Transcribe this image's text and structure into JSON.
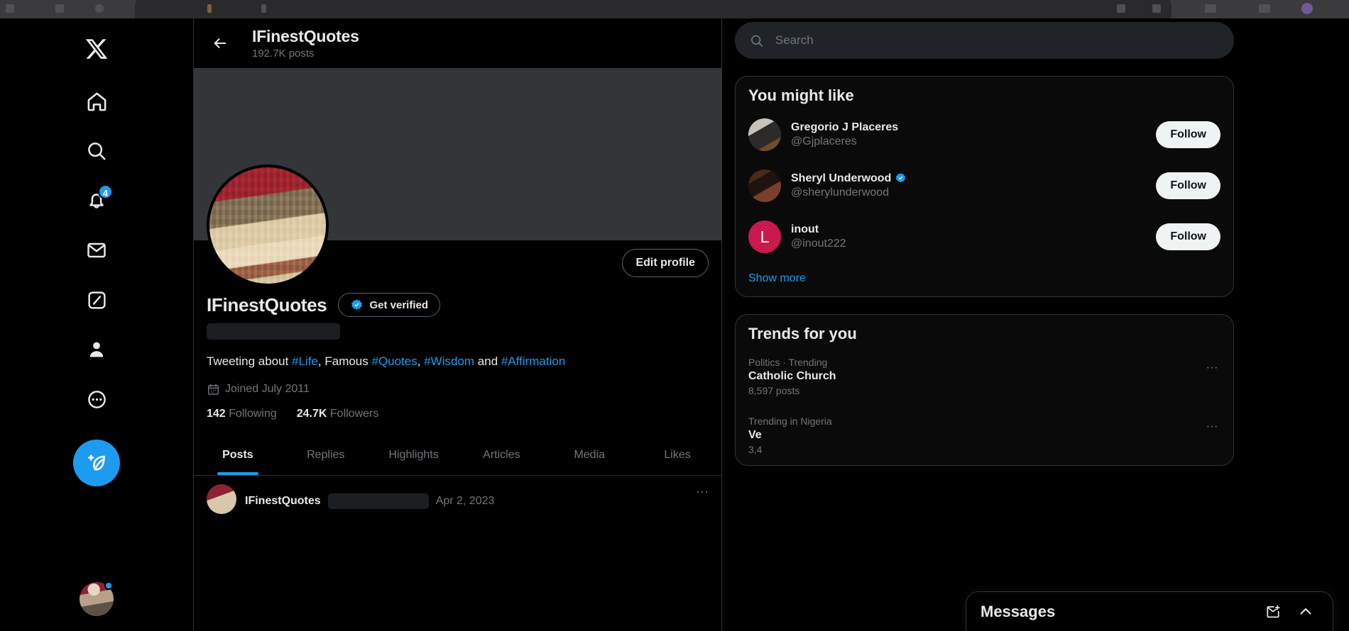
{
  "nav": {
    "items": [
      {
        "name": "x-logo",
        "label": "X"
      },
      {
        "name": "home",
        "label": "Home"
      },
      {
        "name": "explore",
        "label": "Search"
      },
      {
        "name": "notifications",
        "label": "Notifications",
        "badge": "4"
      },
      {
        "name": "messages",
        "label": "Messages"
      },
      {
        "name": "grok",
        "label": "Grok"
      },
      {
        "name": "profile",
        "label": "Profile"
      },
      {
        "name": "more",
        "label": "More"
      }
    ],
    "compose_label": "Post"
  },
  "header": {
    "title": "IFinestQuotes",
    "posts_count": "192.7K posts",
    "back_label": "Back"
  },
  "profile": {
    "display_name": "IFinestQuotes",
    "get_verified_label": "Get verified",
    "edit_profile_label": "Edit profile",
    "bio_prefix": "Tweeting about ",
    "bio_tag_1": "#Life",
    "bio_mid_1": ", Famous ",
    "bio_tag_2": "#Quotes",
    "bio_mid_2": ", ",
    "bio_tag_3": "#Wisdom",
    "bio_mid_3": " and ",
    "bio_tag_4": "#Affirmation",
    "joined": "Joined July 2011",
    "following_count": "142",
    "following_label": "Following",
    "followers_count": "24.7K",
    "followers_label": "Followers"
  },
  "tabs": [
    {
      "label": "Posts",
      "active": true
    },
    {
      "label": "Replies",
      "active": false
    },
    {
      "label": "Highlights",
      "active": false
    },
    {
      "label": "Articles",
      "active": false
    },
    {
      "label": "Media",
      "active": false
    },
    {
      "label": "Likes",
      "active": false
    }
  ],
  "feed_peek": {
    "author": "IFinestQuotes",
    "date": "Apr 2, 2023",
    "more": "···"
  },
  "search": {
    "placeholder": "Search",
    "value": ""
  },
  "you_might_like": {
    "title": "You might like",
    "show_more": "Show more",
    "follow_label": "Follow",
    "items": [
      {
        "name": "Gregorio J Placeres",
        "handle": "@Gjplaceres",
        "verified": false,
        "avatar_kind": "photo-1",
        "initial": ""
      },
      {
        "name": "Sheryl Underwood",
        "handle": "@sherylunderwood",
        "verified": true,
        "avatar_kind": "photo-2",
        "initial": ""
      },
      {
        "name": "inout",
        "handle": "@inout222",
        "verified": false,
        "avatar_kind": "letter",
        "initial": "L",
        "avatar_color": "#c9194e"
      }
    ]
  },
  "trends": {
    "title": "Trends for you",
    "items": [
      {
        "category": "Politics · Trending",
        "name": "Catholic Church",
        "count": "8,597 posts",
        "more": "···"
      },
      {
        "category": "Trending in Nigeria",
        "name": "Ve",
        "count": "3,4",
        "more": "···"
      }
    ]
  },
  "messages_dock": {
    "title": "Messages",
    "new_message_label": "New message",
    "expand_label": "Expand"
  },
  "colors": {
    "accent": "#1d9bf0",
    "verified": "#1d9bf0",
    "follow_bg": "#eff3f4",
    "text": "#e7e9ea",
    "muted": "#71767b",
    "border": "#2f3336",
    "banner": "#333639"
  }
}
